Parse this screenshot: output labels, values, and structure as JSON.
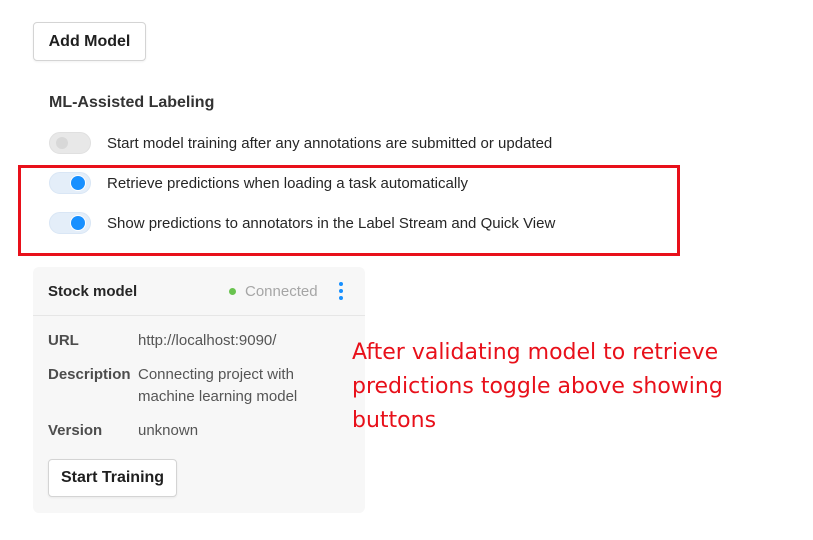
{
  "header": {
    "add_model_label": "Add Model"
  },
  "ml_section": {
    "title": "ML-Assisted Labeling",
    "toggles": [
      {
        "label": "Start model training after any annotations are submitted or updated",
        "checked": false
      },
      {
        "label": "Retrieve predictions when loading a task automatically",
        "checked": true
      },
      {
        "label": "Show predictions to annotators in the Label Stream and Quick View",
        "checked": true
      }
    ]
  },
  "model_card": {
    "title": "Stock model",
    "status": "Connected",
    "status_color": "#69c34f",
    "fields": {
      "url_label": "URL",
      "url_value": "http://localhost:9090/",
      "description_label": "Description",
      "description_value": "Connecting project with machine learning model",
      "version_label": "Version",
      "version_value": "unknown"
    },
    "start_training_label": "Start Training",
    "menu_icon": "more-vertical-icon"
  },
  "annotation": {
    "text": "After validating model to retrieve predictions toggle above showing buttons",
    "color": "#e8101a"
  },
  "colors": {
    "accent": "#1890ff",
    "highlight_border": "#e8101a"
  }
}
